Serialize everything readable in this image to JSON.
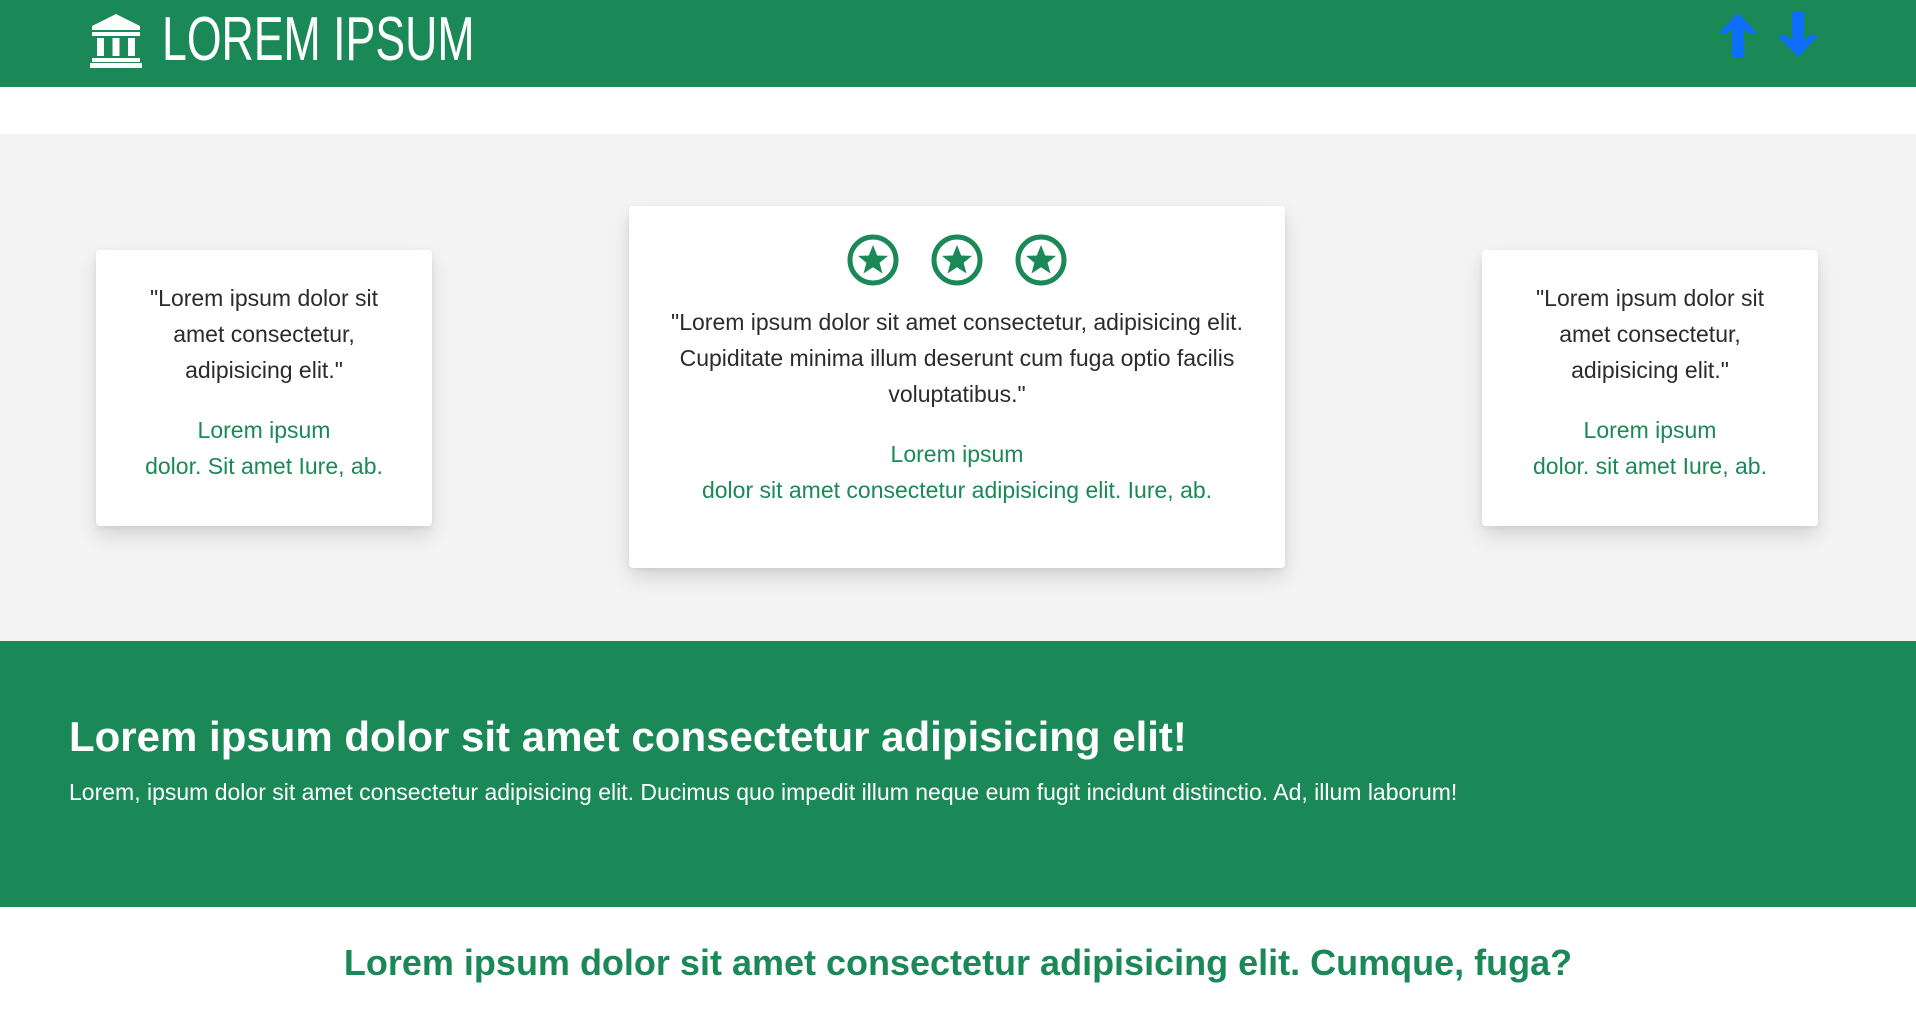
{
  "header": {
    "brand_text": "LOREM IPSUM",
    "brand_icon": "bank-icon",
    "scroll_up_icon": "arrow-up-icon",
    "scroll_down_icon": "arrow-down-icon",
    "background_color": "#1a8957",
    "arrow_color": "#0d6efd"
  },
  "testimonials": {
    "left": {
      "quote": "\"Lorem ipsum dolor sit amet consectetur, adipisicing elit.\"",
      "author_line1": "Lorem ipsum",
      "author_line2": "dolor. Sit amet Iure, ab."
    },
    "center": {
      "rating_icons": [
        "star-circle-icon",
        "star-circle-icon",
        "star-circle-icon"
      ],
      "quote": "\"Lorem ipsum dolor sit amet consectetur, adipisicing elit. Cupiditate minima illum deserunt cum fuga optio facilis voluptatibus.\"",
      "author_line1": "Lorem ipsum",
      "author_line2": "dolor sit amet consectetur adipisicing elit. Iure, ab."
    },
    "right": {
      "quote": "\"Lorem ipsum dolor sit amet consectetur, adipisicing elit.\"",
      "author_line1": "Lorem ipsum",
      "author_line2": "dolor. sit amet Iure, ab."
    }
  },
  "banner": {
    "title": "Lorem ipsum dolor sit amet consectetur adipisicing elit!",
    "text": "Lorem, ipsum dolor sit amet consectetur adipisicing elit. Ducimus quo impedit illum neque eum fugit incidunt distinctio. Ad, illum laborum!"
  },
  "bottom": {
    "heading": "Lorem ipsum dolor sit amet consectetur adipisicing elit. Cumque, fuga?"
  },
  "colors": {
    "brand_green": "#1a8957",
    "section_gray": "#f4f4f4",
    "text_dark": "#2b2b2b"
  }
}
